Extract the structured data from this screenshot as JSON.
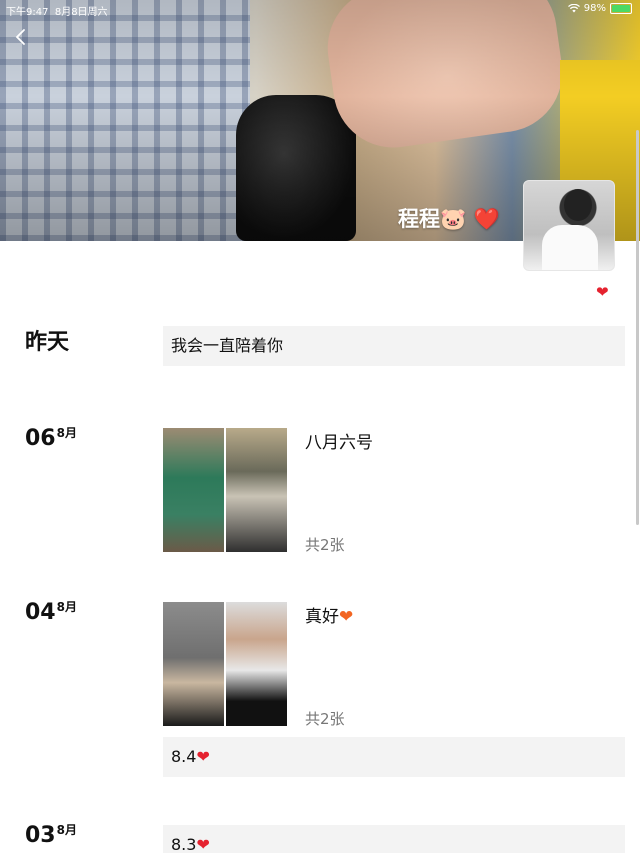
{
  "status_bar": {
    "time": "下午9:47",
    "date": "8月8日周六",
    "battery": "98%",
    "battery_level": 0.98
  },
  "profile": {
    "name": "程程🐷 ❤️"
  },
  "entries": [
    {
      "day": "昨天",
      "text": "我会一直陪着你"
    },
    {
      "day": "06",
      "month": "8月",
      "caption": "八月六号",
      "count": "共2张"
    },
    {
      "day": "04",
      "month": "8月",
      "caption": "真好",
      "count": "共2张",
      "text": "8.4"
    },
    {
      "day": "03",
      "month": "8月",
      "text": "8.3"
    }
  ],
  "icons": {
    "back": "back-chevron-icon",
    "heart": "heart-icon",
    "wifi": "wifi-icon",
    "battery": "battery-icon"
  },
  "colors": {
    "heart_red": "#e5222f",
    "heart_orange": "#f26522",
    "text_box_bg": "#f3f3f3"
  }
}
